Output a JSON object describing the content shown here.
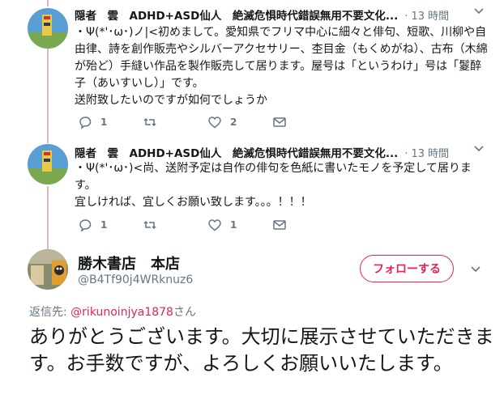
{
  "colors": {
    "accent": "#e0245e",
    "secondary_text": "#657786",
    "thread_line": "#e1b3c8"
  },
  "tweets": [
    {
      "author": "隠者　雲　ADHD+ASD仙人　絶滅危惧時代錯誤無用不要文化...",
      "time": "· 13 時間",
      "text": "・Ψ(*'･ω･)ノ|<初めまして。愛知県でフリマ中心に細々と俳句、短歌、川柳や自由律、詩を創作販売やシルバーアクセサリー、杢目金（もくめがね）、古布（木綿が殆ど）手縫い作品を製作販売して居ります。屋号は「というわけ」号は「鬉醉子（あいすいし）」です。\n送附致したいのですが如何でしょうか",
      "actions": {
        "reply": "1",
        "retweet": "",
        "like": "2",
        "dm": ""
      }
    },
    {
      "author": "隠者　雲　ADHD+ASD仙人　絶滅危惧時代錯誤無用不要文化...",
      "time": "· 13 時間",
      "text": "・Ψ(*'･ω･)<尚、送附予定は自作の俳句を色紙に書いたモノを予定して居ります。\n宜しければ、宜しくお願い致します。。。！！！",
      "actions": {
        "reply": "1",
        "retweet": "",
        "like": "1",
        "dm": ""
      }
    }
  ],
  "main": {
    "name": "勝木書店　本店",
    "handle": "@B4Tf90j4WRknuz6",
    "follow_label": "フォローする",
    "reply_prefix": "返信先: ",
    "reply_user": "@rikunoinjya1878",
    "reply_suffix": "さん",
    "text": "ありがとうございます。大切に展示させていただきます。お手数ですが、よろしくお願いいたします。"
  }
}
